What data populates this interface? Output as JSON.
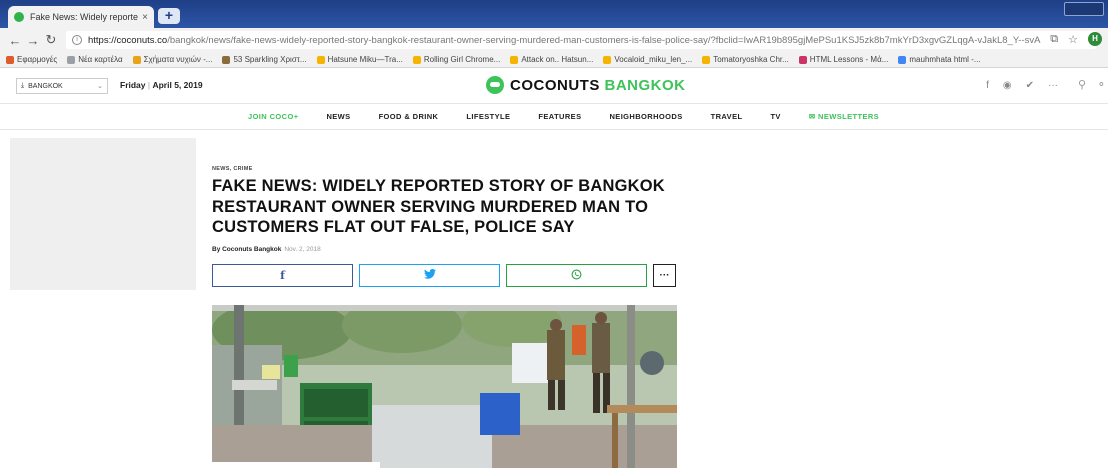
{
  "browser": {
    "tab_title": "Fake News: Widely reported stor",
    "tab_close": "×",
    "new_tab": "+",
    "url_host": "https://coconuts.co",
    "url_path": "/bangkok/news/fake-news-widely-reported-story-bangkok-restaurant-owner-serving-murdered-man-customers-is-false-police-say/?fbclid=IwAR19b895gjMePSu1KSJ5zk8b7mkYrD3xgvGZLqgA-vJakL8_Y--svA",
    "profile_initial": "H",
    "bookmarks": [
      {
        "label": "Εφαρμογές",
        "color": "#e05b2c"
      },
      {
        "label": "Νέα καρτέλα",
        "color": "#9aa0a6"
      },
      {
        "label": "Σχήματα νυχιών -...",
        "color": "#e8a317"
      },
      {
        "label": "53 Sparkling Χριστ...",
        "color": "#8a6d3b"
      },
      {
        "label": "Hatsune Miku—Tra...",
        "color": "#f4b400"
      },
      {
        "label": "Rolling Girl Chrome...",
        "color": "#f4b400"
      },
      {
        "label": "Attack on.. Hatsun...",
        "color": "#f4b400"
      },
      {
        "label": "Vocaloid_miku_len_...",
        "color": "#f4b400"
      },
      {
        "label": "Tomatoryoshka Chr...",
        "color": "#f4b400"
      },
      {
        "label": "HTML Lessons - Μά...",
        "color": "#c36"
      },
      {
        "label": "mauhmhata html -...",
        "color": "#4285f4"
      }
    ]
  },
  "header": {
    "city": "BANGKOK",
    "date_day": "Friday",
    "date_full": "April 5, 2019",
    "logo_brand": "COCONUTS",
    "logo_city": "BANGKOK",
    "social": [
      "f",
      "◉",
      "✔",
      "···"
    ]
  },
  "nav": {
    "join": "JOIN COCO+",
    "items": [
      "NEWS",
      "FOOD & DRINK",
      "LIFESTYLE",
      "FEATURES",
      "NEIGHBORHOODS",
      "TRAVEL",
      "TV"
    ],
    "newsletters": "✉ NEWSLETTERS"
  },
  "article": {
    "kicker": "NEWS, CRIME",
    "headline": "FAKE NEWS: WIDELY REPORTED STORY OF BANGKOK RESTAURANT OWNER SERVING MURDERED MAN TO CUSTOMERS FLAT OUT FALSE, POLICE SAY",
    "byline_prefix": "By Coconuts Bangkok",
    "byline_date": "Nov. 2, 2018",
    "share_fb": "f",
    "share_tw": "🐦",
    "share_wa": "◎",
    "share_more": "···"
  },
  "colors": {
    "brand_green": "#3ec35a",
    "facebook": "#3b5998",
    "twitter": "#1da1f2",
    "whatsapp": "#25a244"
  }
}
